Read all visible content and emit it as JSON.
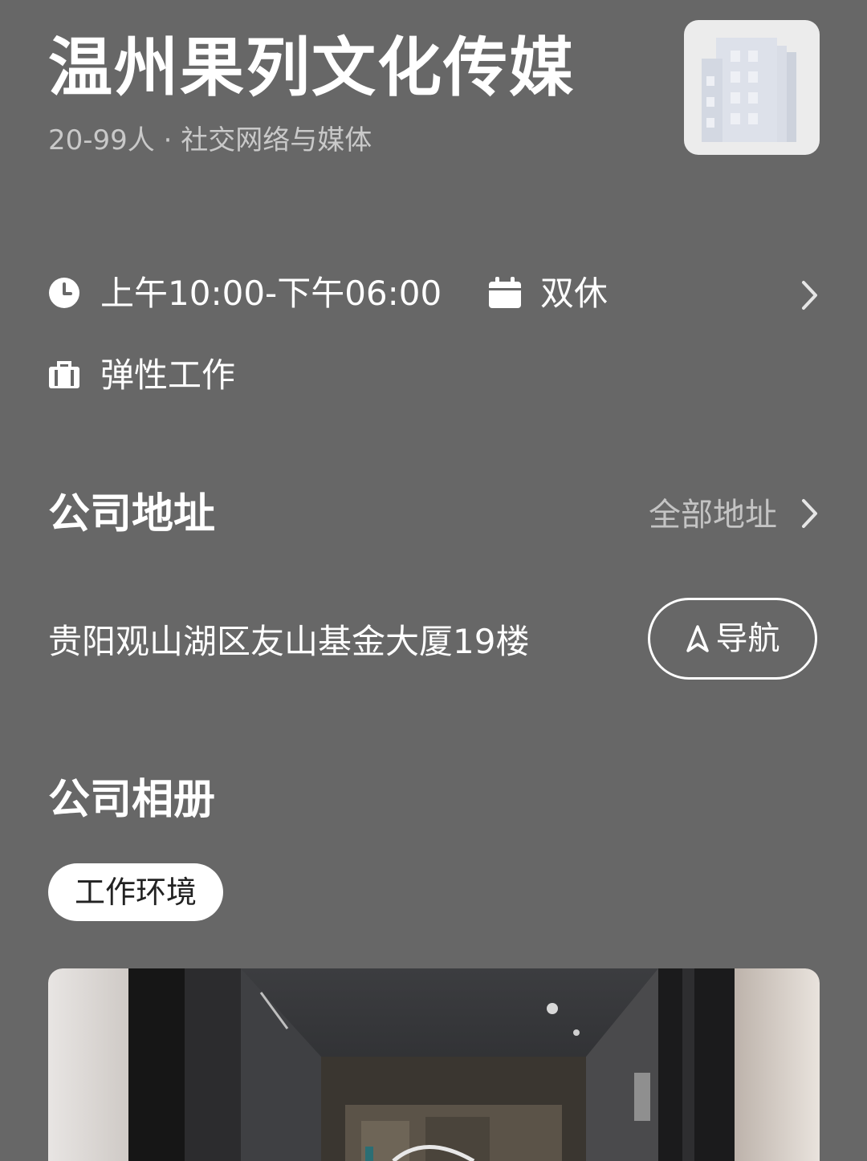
{
  "company": {
    "name": "温州果列文化传媒",
    "meta": "20-99人 · 社交网络与媒体"
  },
  "work_info": {
    "hours": "上午10:00-下午06:00",
    "weekend": "双休",
    "mode": "弹性工作",
    "icons": [
      "clock-icon",
      "calendar-icon",
      "briefcase-icon",
      "chevron-right-icon"
    ]
  },
  "address_section": {
    "title": "公司地址",
    "all_link": "全部地址",
    "address": "贵阳观山湖区友山基金大厦19楼",
    "nav_label": "导航"
  },
  "album_section": {
    "title": "公司相册",
    "tag": "工作环境"
  },
  "colors": {
    "background": "#676767",
    "text": "#ffffff",
    "muted": "#c9c9c9",
    "chip_bg": "#ffffff"
  }
}
